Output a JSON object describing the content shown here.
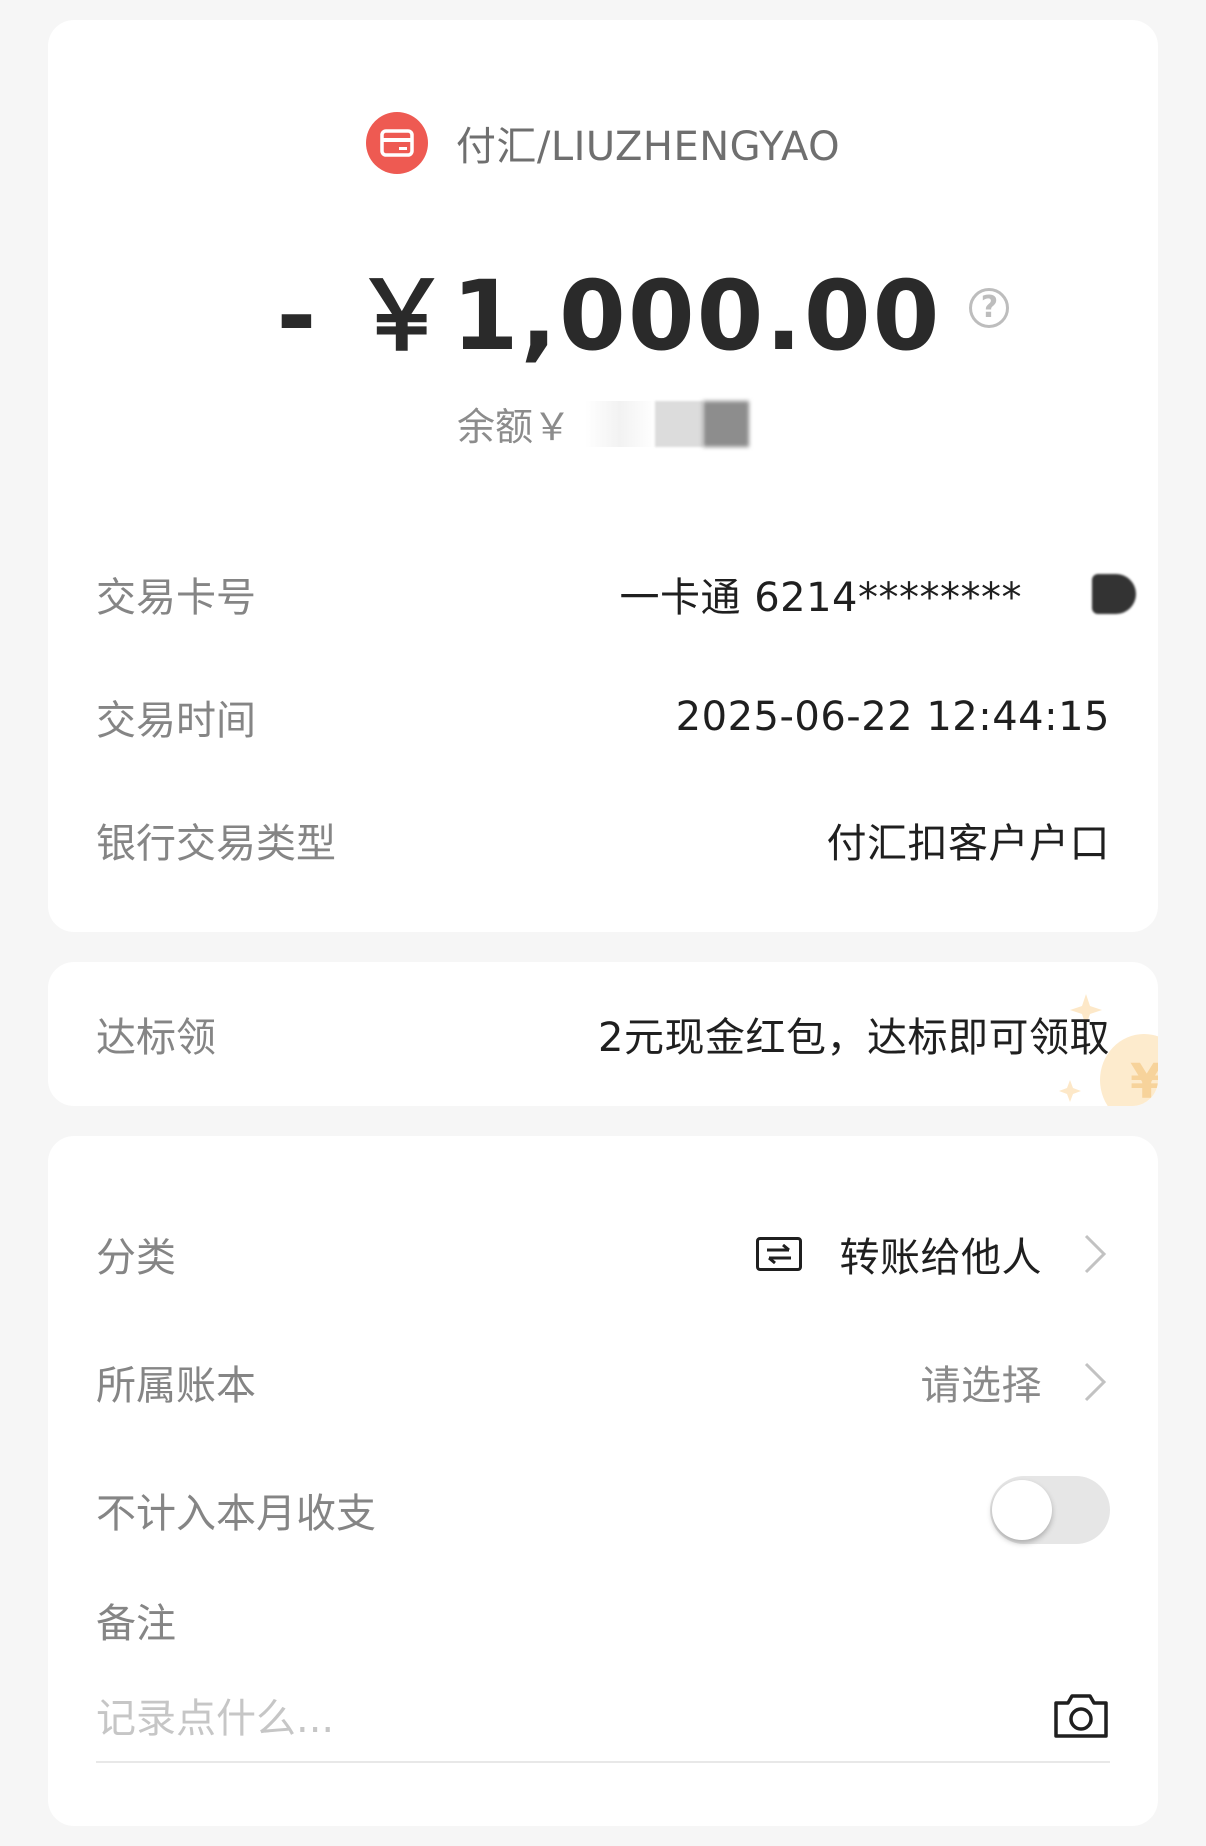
{
  "header": {
    "merchant": "付汇/LIUZHENGYAO",
    "amount": "- ￥1,000.00",
    "balance_label": "余额￥"
  },
  "details": [
    {
      "label": "交易卡号",
      "value": "一卡通 6214********"
    },
    {
      "label": "交易时间",
      "value": "2025-06-22 12:44:15"
    },
    {
      "label": "银行交易类型",
      "value": "付汇扣客户户口"
    }
  ],
  "promo": {
    "label": "达标领",
    "value": "2元现金红包，达标即可领取"
  },
  "meta": {
    "category_label": "分类",
    "category_value": "转账给他人",
    "ledger_label": "所属账本",
    "ledger_value": "请选择",
    "exclude_label": "不计入本月收支",
    "exclude_enabled": false,
    "note_label": "备注",
    "note_placeholder": "记录点什么..."
  },
  "colors": {
    "accent": "#ee5a52",
    "promo_gold": "#f7c77a"
  },
  "icons": {
    "merchant": "bank-card-icon",
    "help": "question-circle-icon",
    "category": "transfer-icon",
    "chevron": "chevron-right-icon",
    "note_attach": "camera-icon"
  }
}
